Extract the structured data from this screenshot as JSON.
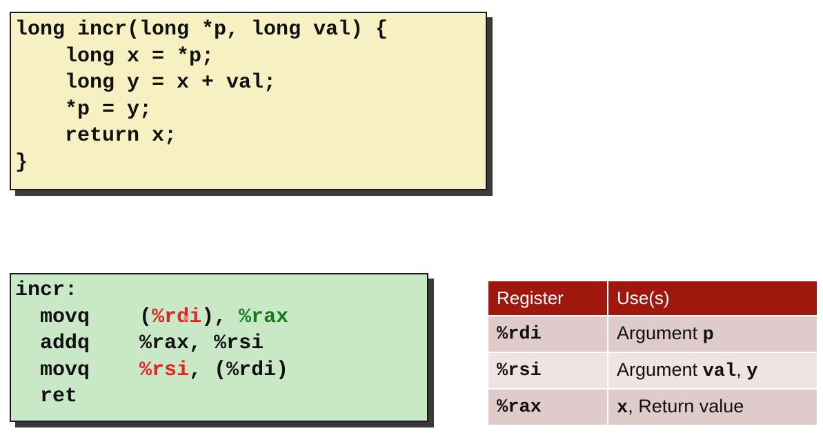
{
  "c_code": {
    "lines": [
      "long incr(long *p, long val) {",
      "    long x = *p;",
      "    long y = x + val;",
      "    *p = y;",
      "    return x;",
      "}"
    ]
  },
  "assembly": {
    "label": "incr:",
    "instructions": [
      {
        "op": "movq",
        "pre": "(",
        "arg1": "%rdi",
        "mid": "), ",
        "arg2": "%rax",
        "post": ""
      },
      {
        "op": "addq",
        "text": "%rax, %rsi"
      },
      {
        "op": "movq",
        "arg1": "%rsi",
        "rest": ", (%rdi)"
      },
      {
        "op": "ret"
      }
    ]
  },
  "register_table": {
    "headers": [
      "Register",
      "Use(s)"
    ],
    "rows": [
      {
        "register": "%rdi",
        "use_text": "Argument ",
        "use_code": "p"
      },
      {
        "register": "%rsi",
        "use_text": "Argument ",
        "use_code": "val",
        "use_sep": ", ",
        "use_code2": "y"
      },
      {
        "register": "%rax",
        "use_code": "x",
        "use_text": ", Return value"
      }
    ]
  },
  "colors": {
    "c_box_bg": "#f6f0c2",
    "asm_box_bg": "#c9e8c6",
    "table_header_bg": "#a0170d",
    "highlight_red": "#e52222",
    "highlight_green": "#1b7a1b"
  }
}
